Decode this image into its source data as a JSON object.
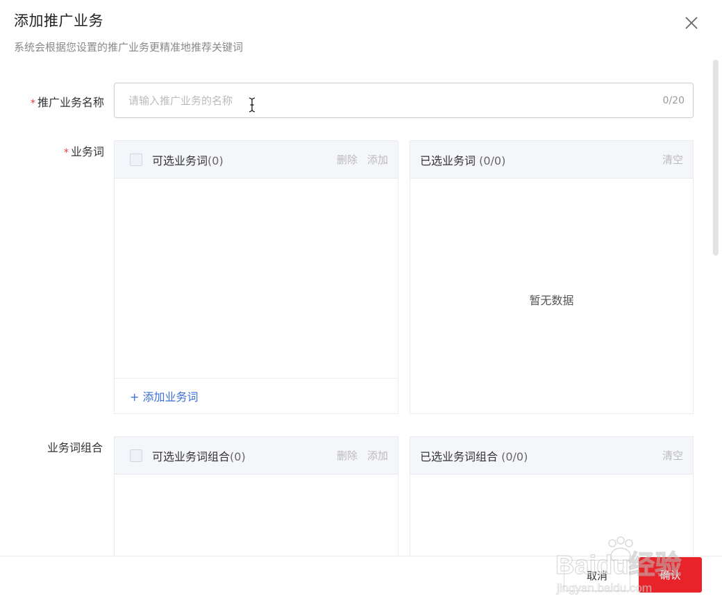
{
  "dialog": {
    "title": "添加推广业务",
    "subtitle": "系统会根据您设置的推广业务更精准地推荐关键词"
  },
  "form": {
    "name_field": {
      "label": "推广业务名称",
      "required_mark": "*",
      "placeholder": "请输入推广业务的名称",
      "counter": "0/20"
    },
    "business_words": {
      "label": "业务词",
      "required_mark": "*",
      "available": {
        "title": "可选业务词",
        "count": "(0)",
        "delete_label": "删除",
        "add_label": "添加",
        "add_link": "+ 添加业务词"
      },
      "selected": {
        "title": "已选业务词",
        "count": "(0/0)",
        "clear_label": "清空",
        "empty_text": "暂无数据"
      }
    },
    "word_combos": {
      "label": "业务词组合",
      "available": {
        "title": "可选业务词组合",
        "count": "(0)",
        "delete_label": "删除",
        "add_label": "添加"
      },
      "selected": {
        "title": "已选业务词组合",
        "count": "(0/0)",
        "clear_label": "清空"
      }
    }
  },
  "footer": {
    "cancel_label": "取消",
    "confirm_label": "确认"
  },
  "watermark": {
    "text": "Baidu经验",
    "url_text": "jingyan.baidu.com"
  },
  "colors": {
    "accent": "#e8232a",
    "link": "#3d6fd8",
    "required": "#e4393c"
  }
}
